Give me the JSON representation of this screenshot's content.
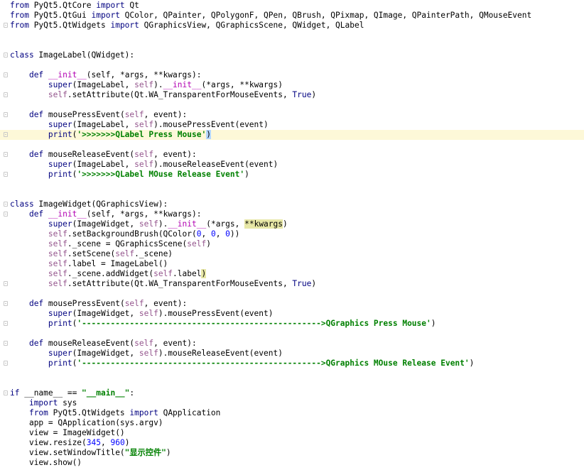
{
  "lines": [
    {
      "i": 0,
      "t": [
        [
          "from ",
          "kw"
        ],
        [
          "PyQt5.QtCore ",
          ""
        ],
        [
          "import ",
          "kw"
        ],
        [
          "Qt",
          ""
        ]
      ]
    },
    {
      "i": 0,
      "t": [
        [
          "from ",
          "kw"
        ],
        [
          "PyQt5.QtGui ",
          ""
        ],
        [
          "import ",
          "kw"
        ],
        [
          "QColor, QPainter, QPolygonF, QPen, QBrush, QPixmap, QImage, QPainterPath, QMouseEvent",
          ""
        ]
      ]
    },
    {
      "i": 0,
      "fold": true,
      "t": [
        [
          "from ",
          "kw"
        ],
        [
          "PyQt5.QtWidgets ",
          ""
        ],
        [
          "import ",
          "kw"
        ],
        [
          "QGraphicsView, QGraphicsScene, QWidget, QLabel",
          ""
        ]
      ]
    },
    {
      "i": 0,
      "t": []
    },
    {
      "i": 0,
      "t": []
    },
    {
      "i": 0,
      "fold": true,
      "t": [
        [
          "class ",
          "kw"
        ],
        [
          "ImageLabel(QWidget):",
          ""
        ]
      ]
    },
    {
      "i": 0,
      "t": []
    },
    {
      "i": 0,
      "fold": true,
      "t": [
        [
          "    "
        ],
        [
          "def ",
          "kw"
        ],
        [
          "__init__",
          "dun"
        ],
        [
          "(self, ",
          ""
        ],
        [
          "*args, **kwargs",
          ""
        ],
        [
          "):",
          ""
        ]
      ]
    },
    {
      "i": 0,
      "t": [
        [
          "        "
        ],
        [
          "super",
          "bi"
        ],
        [
          "(ImageLabel, ",
          ""
        ],
        [
          "self",
          "self"
        ],
        [
          ").",
          ""
        ],
        [
          "__init__",
          "dun"
        ],
        [
          "(",
          ""
        ],
        [
          "*args, **kwargs",
          ""
        ],
        [
          ")",
          ""
        ]
      ]
    },
    {
      "i": 0,
      "fold": true,
      "t": [
        [
          "        "
        ],
        [
          "self",
          "self"
        ],
        [
          ".setAttribute(Qt.WA_TransparentForMouseEvents, ",
          ""
        ],
        [
          "True",
          "kw"
        ],
        [
          ")",
          ""
        ]
      ]
    },
    {
      "i": 0,
      "t": []
    },
    {
      "i": 0,
      "fold": true,
      "t": [
        [
          "    "
        ],
        [
          "def ",
          "kw"
        ],
        [
          "mousePressEvent(",
          ""
        ],
        [
          "self",
          "self"
        ],
        [
          ", event):",
          ""
        ]
      ]
    },
    {
      "i": 0,
      "t": [
        [
          "        "
        ],
        [
          "super",
          "bi"
        ],
        [
          "(ImageLabel, ",
          ""
        ],
        [
          "self",
          "self"
        ],
        [
          ").mousePressEvent(event)",
          ""
        ]
      ]
    },
    {
      "i": 0,
      "hl": true,
      "fold": true,
      "t": [
        [
          "        "
        ],
        [
          "print",
          "bi"
        ],
        [
          "(",
          ""
        ],
        [
          "'>>>>>>>QLabel Press Mouse'",
          "str"
        ],
        [
          ")",
          "brm"
        ]
      ]
    },
    {
      "i": 0,
      "t": []
    },
    {
      "i": 0,
      "fold": true,
      "t": [
        [
          "    "
        ],
        [
          "def ",
          "kw"
        ],
        [
          "mouseReleaseEvent(",
          ""
        ],
        [
          "self",
          "self"
        ],
        [
          ", event):",
          ""
        ]
      ]
    },
    {
      "i": 0,
      "t": [
        [
          "        "
        ],
        [
          "super",
          "bi"
        ],
        [
          "(ImageLabel, ",
          ""
        ],
        [
          "self",
          "self"
        ],
        [
          ").mouseReleaseEvent(event)",
          ""
        ]
      ]
    },
    {
      "i": 0,
      "fold": true,
      "t": [
        [
          "        "
        ],
        [
          "print",
          "bi"
        ],
        [
          "(",
          ""
        ],
        [
          "'>>>>>>>QLabel MOuse Release Event'",
          "str"
        ],
        [
          ")",
          ""
        ]
      ]
    },
    {
      "i": 0,
      "t": []
    },
    {
      "i": 0,
      "t": []
    },
    {
      "i": 0,
      "fold": true,
      "t": [
        [
          "class ",
          "kw"
        ],
        [
          "ImageWidget(QGraphicsView):",
          ""
        ]
      ]
    },
    {
      "i": 0,
      "fold": true,
      "t": [
        [
          "    "
        ],
        [
          "def ",
          "kw"
        ],
        [
          "__init__",
          "dun"
        ],
        [
          "(self, ",
          ""
        ],
        [
          "*args, **kwargs",
          ""
        ],
        [
          "):",
          ""
        ]
      ]
    },
    {
      "i": 0,
      "t": [
        [
          "        "
        ],
        [
          "super",
          "bi"
        ],
        [
          "(ImageWidget, ",
          ""
        ],
        [
          "self",
          "self"
        ],
        [
          ").",
          ""
        ],
        [
          "__init__",
          "dun"
        ],
        [
          "(",
          ""
        ],
        [
          "*args, ",
          ""
        ],
        [
          "**kwargs",
          "yel"
        ],
        [
          ")",
          ""
        ]
      ]
    },
    {
      "i": 0,
      "t": [
        [
          "        "
        ],
        [
          "self",
          "self"
        ],
        [
          ".setBackgroundBrush(QColor(",
          ""
        ],
        [
          "0",
          "nm"
        ],
        [
          ", ",
          ""
        ],
        [
          "0",
          "nm"
        ],
        [
          ", ",
          ""
        ],
        [
          "0",
          "nm"
        ],
        [
          "))",
          ""
        ]
      ]
    },
    {
      "i": 0,
      "t": [
        [
          "        "
        ],
        [
          "self",
          "self"
        ],
        [
          "._scene = QGraphicsScene(",
          ""
        ],
        [
          "self",
          "self"
        ],
        [
          ")",
          ""
        ]
      ]
    },
    {
      "i": 0,
      "t": [
        [
          "        "
        ],
        [
          "self",
          "self"
        ],
        [
          ".setScene(",
          ""
        ],
        [
          "self",
          "self"
        ],
        [
          "._scene)",
          ""
        ]
      ]
    },
    {
      "i": 0,
      "t": [
        [
          "        "
        ],
        [
          "self",
          "self"
        ],
        [
          ".label = ImageLabel()",
          ""
        ]
      ]
    },
    {
      "i": 0,
      "t": [
        [
          "        "
        ],
        [
          "self",
          "self"
        ],
        [
          "._scene.addWidget(",
          ""
        ],
        [
          "self",
          "self"
        ],
        [
          ".label",
          ""
        ],
        [
          ")",
          "yel"
        ]
      ]
    },
    {
      "i": 0,
      "fold": true,
      "t": [
        [
          "        "
        ],
        [
          "self",
          "self"
        ],
        [
          ".setAttribute(Qt.WA_TransparentForMouseEvents, ",
          ""
        ],
        [
          "True",
          "kw"
        ],
        [
          ")",
          ""
        ]
      ]
    },
    {
      "i": 0,
      "t": []
    },
    {
      "i": 0,
      "fold": true,
      "t": [
        [
          "    "
        ],
        [
          "def ",
          "kw"
        ],
        [
          "mousePressEvent(",
          ""
        ],
        [
          "self",
          "self"
        ],
        [
          ", event):",
          ""
        ]
      ]
    },
    {
      "i": 0,
      "t": [
        [
          "        "
        ],
        [
          "super",
          "bi"
        ],
        [
          "(ImageWidget, ",
          ""
        ],
        [
          "self",
          "self"
        ],
        [
          ").mousePressEvent(event)",
          ""
        ]
      ]
    },
    {
      "i": 0,
      "fold": true,
      "t": [
        [
          "        "
        ],
        [
          "print",
          "bi"
        ],
        [
          "(",
          ""
        ],
        [
          "'-------------------------------------------------->QGraphics Press Mouse'",
          "str"
        ],
        [
          ")",
          ""
        ]
      ]
    },
    {
      "i": 0,
      "t": []
    },
    {
      "i": 0,
      "fold": true,
      "t": [
        [
          "    "
        ],
        [
          "def ",
          "kw"
        ],
        [
          "mouseReleaseEvent(",
          ""
        ],
        [
          "self",
          "self"
        ],
        [
          ", event):",
          ""
        ]
      ]
    },
    {
      "i": 0,
      "t": [
        [
          "        "
        ],
        [
          "super",
          "bi"
        ],
        [
          "(ImageWidget, ",
          ""
        ],
        [
          "self",
          "self"
        ],
        [
          ").mouseReleaseEvent(event)",
          ""
        ]
      ]
    },
    {
      "i": 0,
      "fold": true,
      "t": [
        [
          "        "
        ],
        [
          "print",
          "bi"
        ],
        [
          "(",
          ""
        ],
        [
          "'-------------------------------------------------->QGraphics MOuse Release Event'",
          "str"
        ],
        [
          ")",
          ""
        ]
      ]
    },
    {
      "i": 0,
      "t": []
    },
    {
      "i": 0,
      "t": []
    },
    {
      "i": 0,
      "fold": true,
      "t": [
        [
          "if ",
          "kw"
        ],
        [
          "__name__ == ",
          ""
        ],
        [
          "\"__main__\"",
          "str"
        ],
        [
          ":",
          ""
        ]
      ]
    },
    {
      "i": 0,
      "t": [
        [
          "    "
        ],
        [
          "import ",
          "kw"
        ],
        [
          "sys",
          ""
        ]
      ]
    },
    {
      "i": 0,
      "t": [
        [
          "    "
        ],
        [
          "from ",
          "kw"
        ],
        [
          "PyQt5.QtWidgets ",
          ""
        ],
        [
          "import ",
          "kw"
        ],
        [
          "QApplication",
          ""
        ]
      ]
    },
    {
      "i": 0,
      "t": [
        [
          "    "
        ],
        [
          "app = QApplication(sys.argv)",
          ""
        ]
      ]
    },
    {
      "i": 0,
      "t": [
        [
          "    "
        ],
        [
          "view = ImageWidget()",
          ""
        ]
      ]
    },
    {
      "i": 0,
      "t": [
        [
          "    "
        ],
        [
          "view.resize(",
          ""
        ],
        [
          "345",
          "nm"
        ],
        [
          ", ",
          ""
        ],
        [
          "960",
          "nm"
        ],
        [
          ")",
          ""
        ]
      ]
    },
    {
      "i": 0,
      "t": [
        [
          "    "
        ],
        [
          "view.setWindowTitle(",
          ""
        ],
        [
          "\"显示控件\"",
          "str"
        ],
        [
          ")",
          ""
        ]
      ]
    },
    {
      "i": 0,
      "t": [
        [
          "    "
        ],
        [
          "view.show()",
          ""
        ]
      ]
    }
  ]
}
